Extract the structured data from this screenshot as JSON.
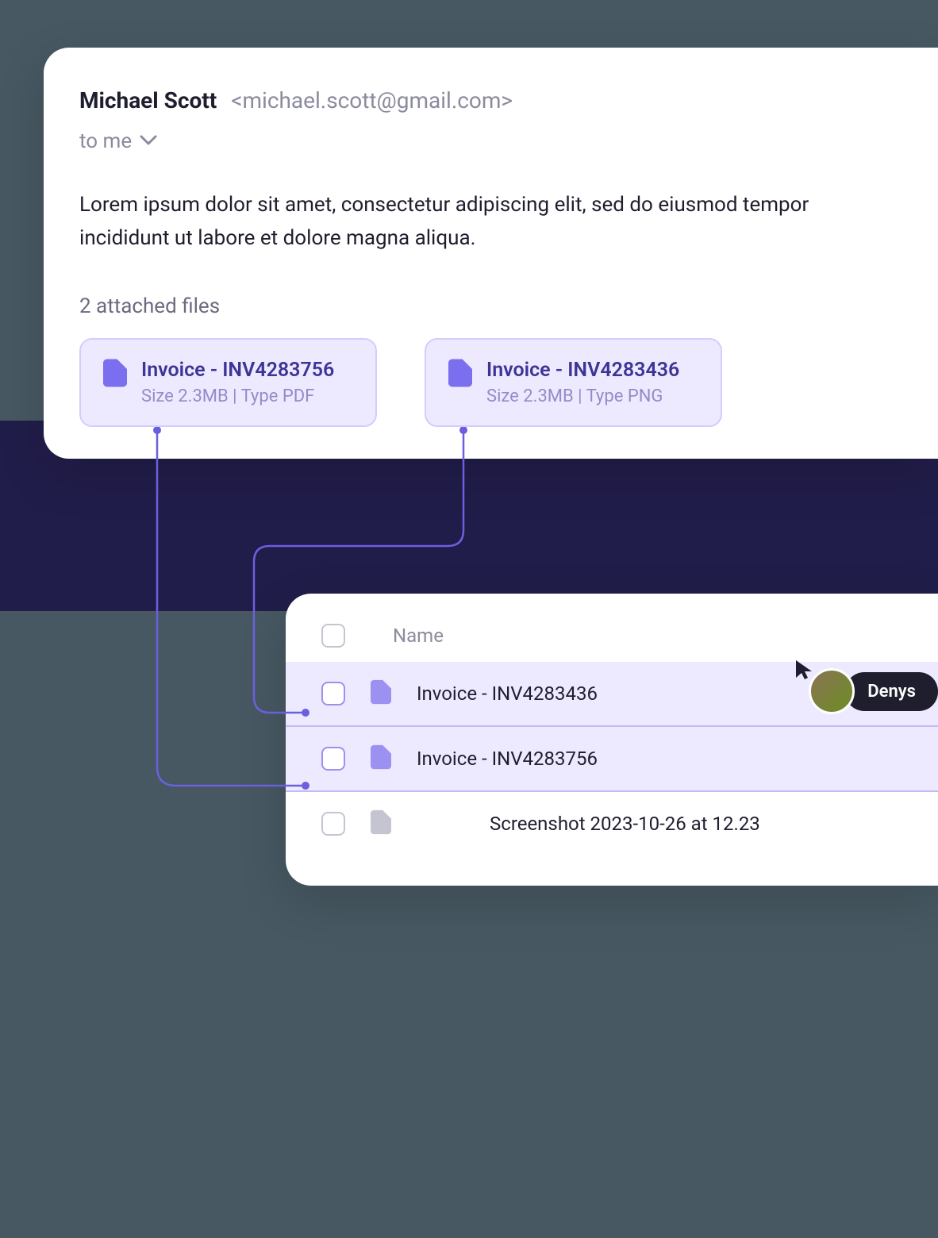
{
  "email": {
    "sender_name": "Michael Scott",
    "sender_email": "<michael.scott@gmail.com>",
    "to_label": "to me",
    "body": "Lorem ipsum dolor sit amet, consectetur adipiscing elit, sed do eiusmod tempor incididunt ut labore et dolore magna aliqua.",
    "attachments_label": "2 attached files",
    "attachments": [
      {
        "title": "Invoice - INV4283756",
        "meta": "Size 2.3MB  |  Type PDF"
      },
      {
        "title": "Invoice - INV4283436",
        "meta": "Size 2.3MB  |  Type PNG"
      }
    ]
  },
  "file_list": {
    "header_label": "Name",
    "rows": [
      {
        "name": "Invoice - INV4283436",
        "highlighted": true
      },
      {
        "name": "Invoice - INV4283756",
        "highlighted": true
      },
      {
        "name": "Screenshot 2023-10-26 at 12.23",
        "highlighted": false
      }
    ]
  },
  "cursor_user": "Denys",
  "colors": {
    "accent": "#7b6fef",
    "highlight_bg": "#edeaff"
  }
}
